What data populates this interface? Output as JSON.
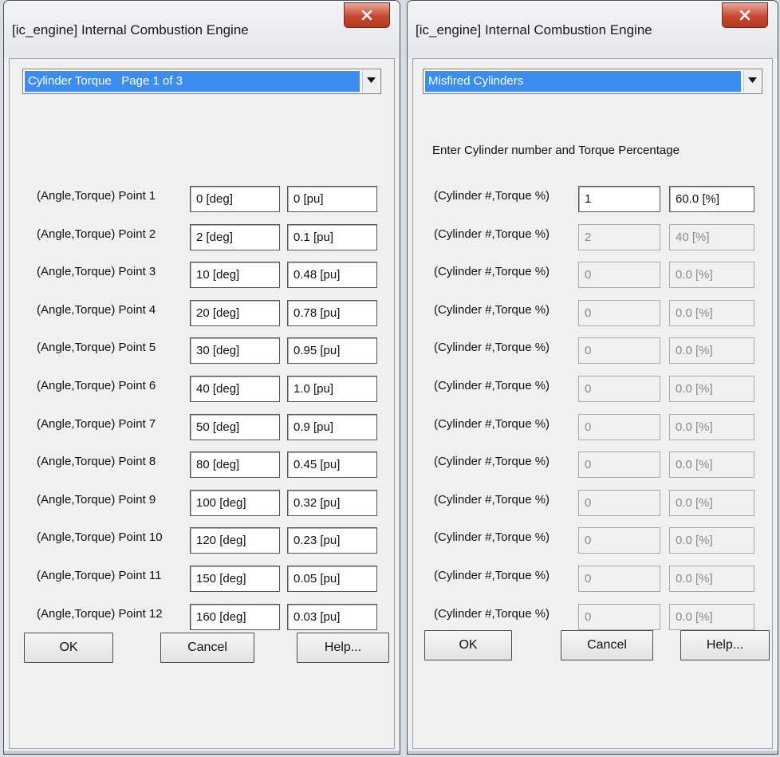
{
  "left_dialog": {
    "title": "[ic_engine] Internal Combustion Engine",
    "dropdown_value": "Cylinder Torque   Page 1 of 3",
    "rows": [
      {
        "label": "(Angle,Torque) Point 1",
        "angle": "0 [deg]",
        "torque": "0 [pu]"
      },
      {
        "label": "(Angle,Torque) Point 2",
        "angle": "2 [deg]",
        "torque": "0.1 [pu]"
      },
      {
        "label": "(Angle,Torque) Point 3",
        "angle": "10 [deg]",
        "torque": "0.48 [pu]"
      },
      {
        "label": "(Angle,Torque) Point 4",
        "angle": "20 [deg]",
        "torque": "0.78 [pu]"
      },
      {
        "label": "(Angle,Torque) Point 5",
        "angle": "30 [deg]",
        "torque": "0.95 [pu]"
      },
      {
        "label": "(Angle,Torque) Point 6",
        "angle": "40 [deg]",
        "torque": "1.0 [pu]"
      },
      {
        "label": "(Angle,Torque) Point 7",
        "angle": "50 [deg]",
        "torque": "0.9 [pu]"
      },
      {
        "label": "(Angle,Torque) Point 8",
        "angle": "80 [deg]",
        "torque": "0.45 [pu]"
      },
      {
        "label": "(Angle,Torque) Point 9",
        "angle": "100 [deg]",
        "torque": "0.32 [pu]"
      },
      {
        "label": "(Angle,Torque) Point 10",
        "angle": "120 [deg]",
        "torque": "0.23 [pu]"
      },
      {
        "label": "(Angle,Torque) Point 11",
        "angle": "150 [deg]",
        "torque": "0.05 [pu]"
      },
      {
        "label": "(Angle,Torque) Point 12",
        "angle": "160 [deg]",
        "torque": "0.03 [pu]"
      }
    ],
    "buttons": {
      "ok": "OK",
      "cancel": "Cancel",
      "help": "Help..."
    }
  },
  "right_dialog": {
    "title": "[ic_engine] Internal Combustion Engine",
    "dropdown_value": "Misfired Cylinders",
    "instruction": "Enter Cylinder number and Torque Percentage",
    "rows": [
      {
        "label": "(Cylinder #,Torque %)",
        "cylinder": "1",
        "torque": "60.0 [%]",
        "enabled": true
      },
      {
        "label": "(Cylinder #,Torque %)",
        "cylinder": "2",
        "torque": "40 [%]",
        "enabled": false
      },
      {
        "label": "(Cylinder #,Torque %)",
        "cylinder": "0",
        "torque": "0.0 [%]",
        "enabled": false
      },
      {
        "label": "(Cylinder #,Torque %)",
        "cylinder": "0",
        "torque": "0.0 [%]",
        "enabled": false
      },
      {
        "label": "(Cylinder #,Torque %)",
        "cylinder": "0",
        "torque": "0.0 [%]",
        "enabled": false
      },
      {
        "label": "(Cylinder #,Torque %)",
        "cylinder": "0",
        "torque": "0.0 [%]",
        "enabled": false
      },
      {
        "label": "(Cylinder #,Torque %)",
        "cylinder": "0",
        "torque": "0.0 [%]",
        "enabled": false
      },
      {
        "label": "(Cylinder #,Torque %)",
        "cylinder": "0",
        "torque": "0.0 [%]",
        "enabled": false
      },
      {
        "label": "(Cylinder #,Torque %)",
        "cylinder": "0",
        "torque": "0.0 [%]",
        "enabled": false
      },
      {
        "label": "(Cylinder #,Torque %)",
        "cylinder": "0",
        "torque": "0.0 [%]",
        "enabled": false
      },
      {
        "label": "(Cylinder #,Torque %)",
        "cylinder": "0",
        "torque": "0.0 [%]",
        "enabled": false
      },
      {
        "label": "(Cylinder #,Torque %)",
        "cylinder": "0",
        "torque": "0.0 [%]",
        "enabled": false
      }
    ],
    "buttons": {
      "ok": "OK",
      "cancel": "Cancel",
      "help": "Help..."
    }
  },
  "icons": {
    "close": "close-x-icon",
    "dropdown": "chevron-down-icon"
  },
  "colors": {
    "selection": "#3b8ef0",
    "close_button": "#c9462f"
  }
}
